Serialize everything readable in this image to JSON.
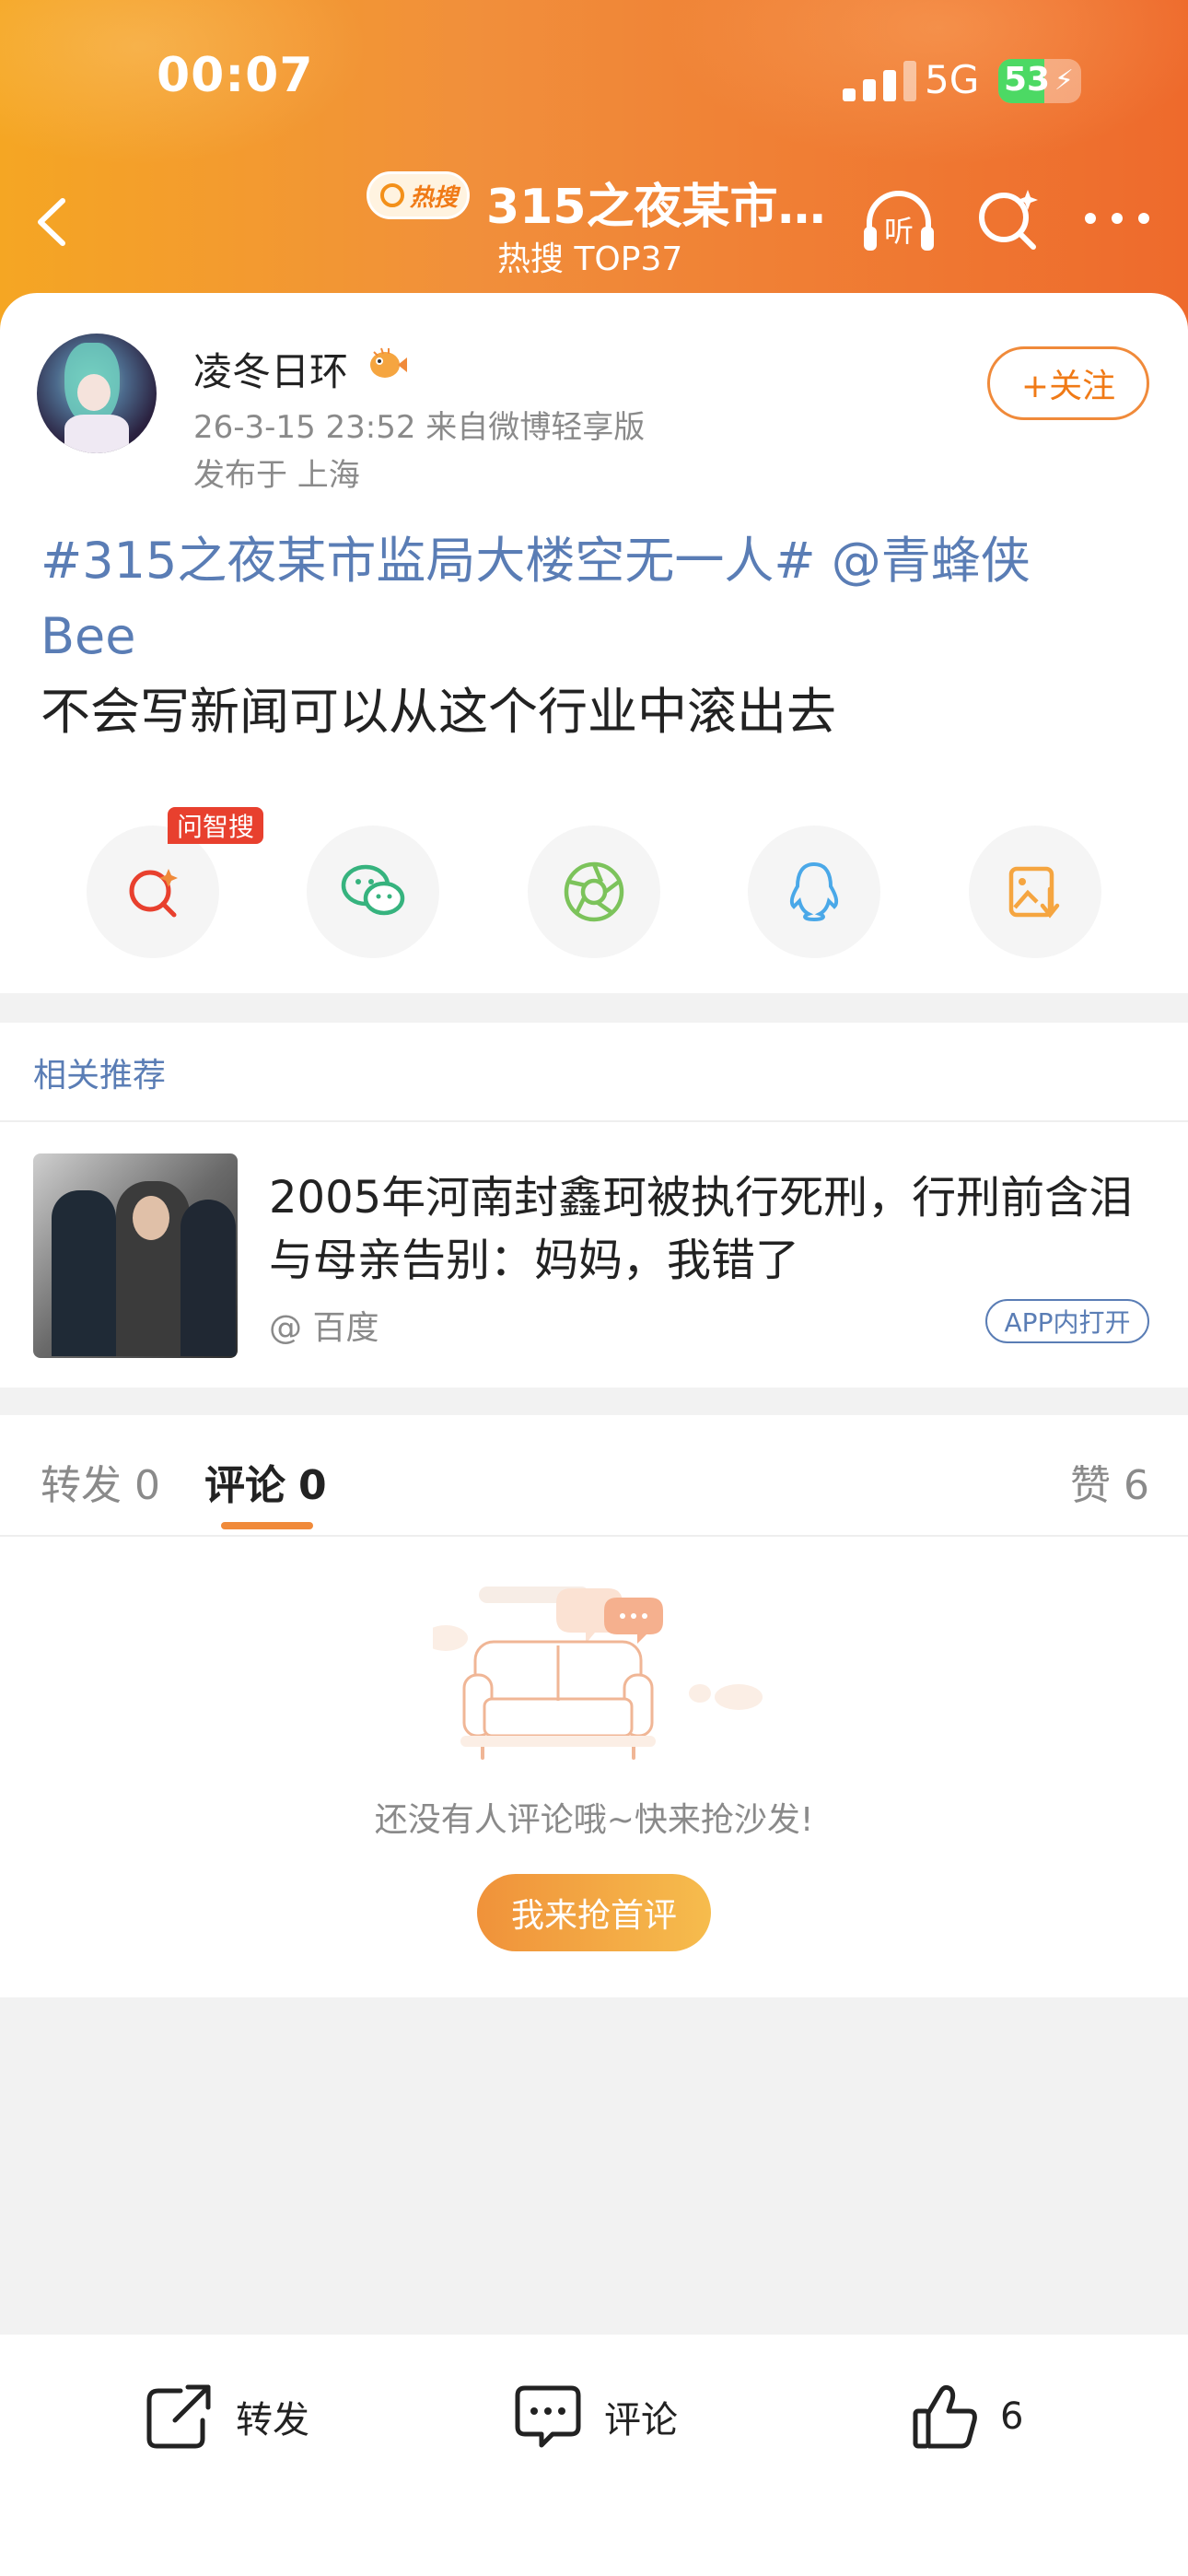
{
  "status_bar": {
    "time": "00:07",
    "network": "5G",
    "battery": "53"
  },
  "header": {
    "badge": "热搜",
    "title": "315之夜某市…",
    "subtitle": "热搜 TOP37",
    "listen_label": "听"
  },
  "post": {
    "username": "凌冬日环",
    "meta": "26-3-15 23:52  来自微博轻享版",
    "location": "发布于 上海",
    "follow_label": "+关注",
    "text_line1": "#315之夜某市监局大楼空无一人# @青蜂侠",
    "text_line2": "Bee",
    "text_line3": "不会写新闻可以从这个行业中滚出去"
  },
  "share": {
    "tag": "问智搜",
    "items": [
      "wenzhisou-search-icon",
      "wechat-icon",
      "moments-icon",
      "qq-icon",
      "save-image-icon"
    ]
  },
  "related": {
    "header": "相关推荐",
    "title": "2005年河南封鑫珂被执行死刑，行刑前含泪与母亲告别：妈妈，我错了",
    "source": "@ 百度",
    "app_button": "APP内打开"
  },
  "comments": {
    "tabs": {
      "repost_label": "转发",
      "repost_count": "0",
      "comment_label": "评论",
      "comment_count": "0",
      "like_label": "赞",
      "like_count": "6"
    },
    "empty_text": "还没有人评论哦~快来抢沙发!",
    "first_comment_button": "我来抢首评"
  },
  "bottom_bar": {
    "repost": "转发",
    "comment": "评论",
    "like_count": "6"
  },
  "colors": {
    "accent": "#f08a3a",
    "link": "#5a7db5",
    "header_start": "#f5a623",
    "header_end": "#ee6a2c"
  }
}
